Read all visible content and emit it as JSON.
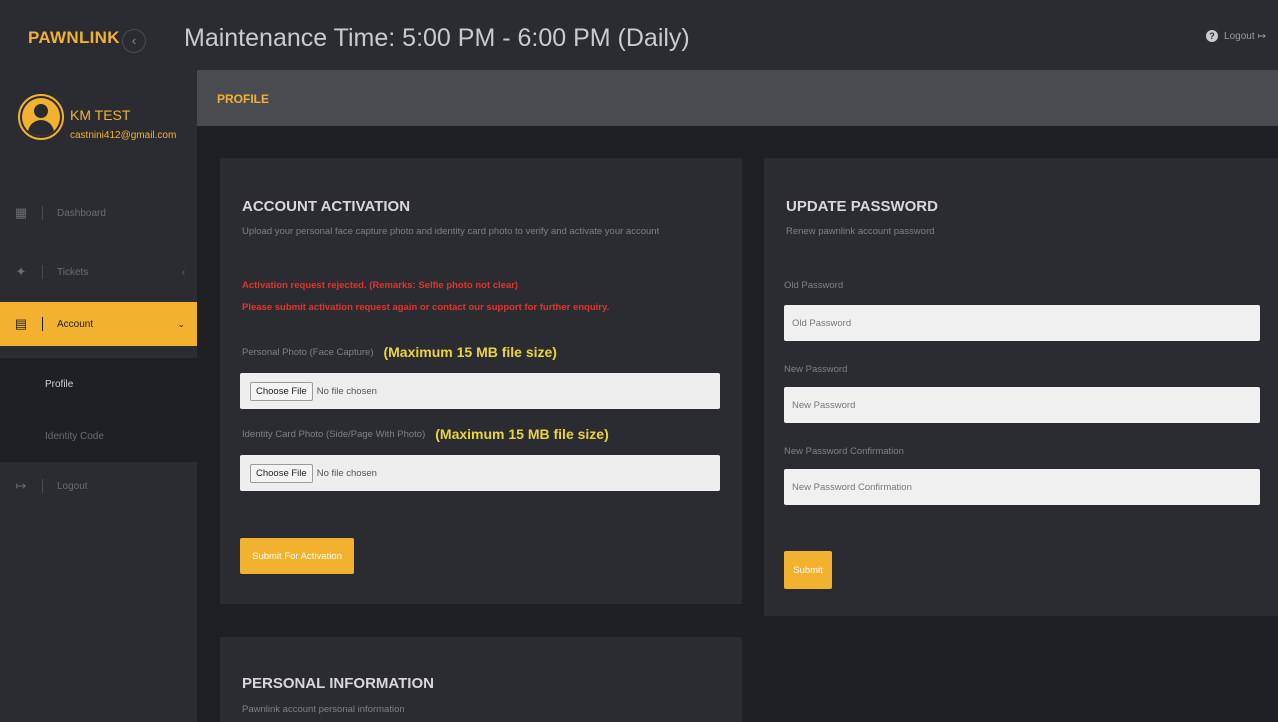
{
  "topbar": {
    "brand": "PAWNLINK",
    "collapse_icon": "chevron-left-icon",
    "maintenance": "Maintenance Time: 5:00 PM - 6:00 PM (Daily)",
    "help_glyph": "?",
    "logout_label": "Logout",
    "logout_glyph": "↦"
  },
  "user": {
    "name": "KM TEST",
    "email": "castnini412@gmail.com"
  },
  "sidebar": {
    "items": [
      {
        "label": "Dashboard",
        "icon": "dashboard-icon",
        "glyph": "▦"
      },
      {
        "label": "Tickets",
        "icon": "ticket-icon",
        "glyph": "✦",
        "caret": "‹"
      },
      {
        "label": "Account",
        "icon": "id-card-icon",
        "glyph": "▤",
        "caret": "⌄"
      },
      {
        "label": "Logout",
        "icon": "logout-icon",
        "glyph": "↦"
      }
    ],
    "subitems": [
      {
        "label": "Profile"
      },
      {
        "label": "Identity Code"
      }
    ]
  },
  "page": {
    "title": "PROFILE"
  },
  "activation": {
    "title": "ACCOUNT ACTIVATION",
    "desc": "Upload your personal face capture photo and identity card photo to verify and activate your account",
    "error1": "Activation request rejected. (Remarks: Selfie photo not clear)",
    "error2": "Please submit activation request again or contact our support for further enquiry.",
    "photo_label": "Personal Photo (Face Capture)",
    "photo_note": "(Maximum 15 MB file size)",
    "id_label": "Identity Card Photo (Side/Page With Photo)",
    "id_note": "(Maximum 15 MB file size)",
    "choose_file": "Choose File",
    "no_file": "No file chosen",
    "submit": "Submit For Activation"
  },
  "password": {
    "title": "UPDATE PASSWORD",
    "desc": "Renew pawnlink account password",
    "old_label": "Old Password",
    "old_placeholder": "Old Password",
    "new_label": "New Password",
    "new_placeholder": "New Password",
    "confirm_label": "New Password Confirmation",
    "confirm_placeholder": "New Password Confirmation",
    "submit": "Submit"
  },
  "personal": {
    "title": "PERSONAL INFORMATION",
    "desc": "Pawnlink account personal information"
  },
  "colors": {
    "accent": "#f2b230",
    "error": "#e0352b",
    "note": "#ecd43b",
    "background": "#1f2024",
    "panel": "#2b2c31"
  }
}
